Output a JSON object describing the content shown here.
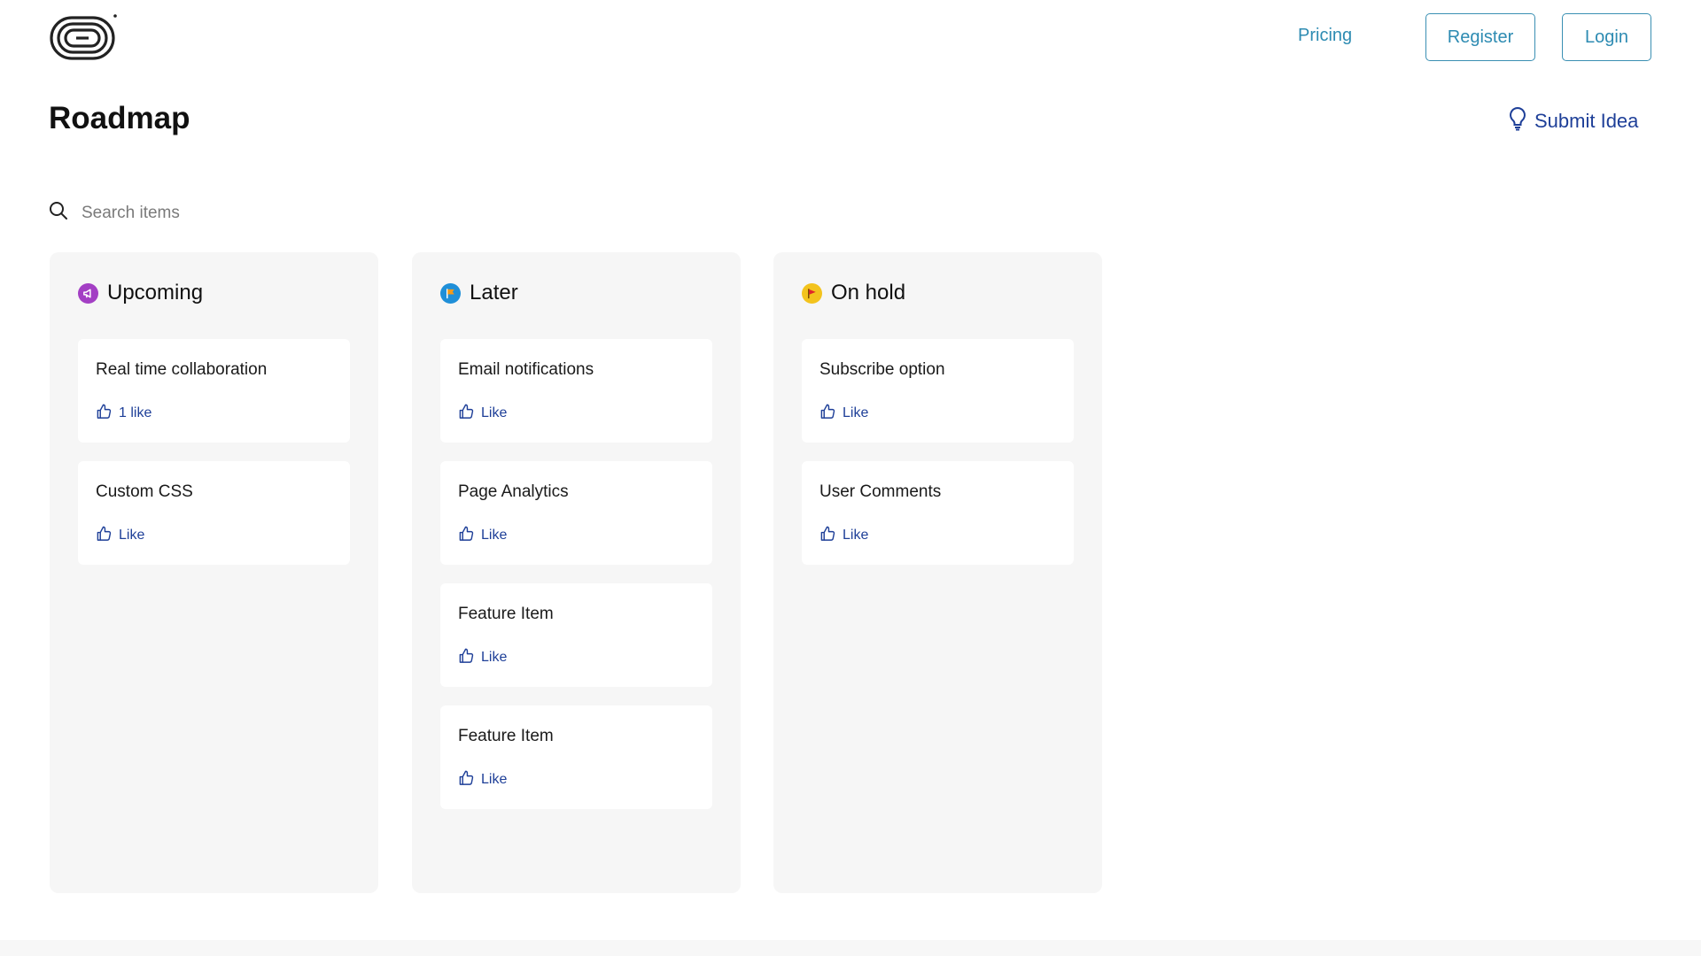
{
  "header": {
    "logo_icon": "brand-logo-icon",
    "nav": {
      "pricing": "Pricing",
      "register": "Register",
      "login": "Login"
    }
  },
  "page": {
    "title": "Roadmap",
    "submit_idea": "Submit Idea"
  },
  "search": {
    "placeholder": "Search items",
    "icon": "search-icon"
  },
  "columns": [
    {
      "title": "Upcoming",
      "icon": "megaphone-icon",
      "icon_color": "#a33fc4",
      "items": [
        {
          "title": "Real time collaboration",
          "like": "1 like"
        },
        {
          "title": "Custom CSS",
          "like": "Like"
        }
      ]
    },
    {
      "title": "Later",
      "icon": "flag-icon",
      "icon_color": "#1f8fd8",
      "items": [
        {
          "title": "Email notifications",
          "like": "Like"
        },
        {
          "title": "Page Analytics",
          "like": "Like"
        },
        {
          "title": "Feature Item",
          "like": "Like"
        },
        {
          "title": "Feature Item",
          "like": "Like"
        }
      ]
    },
    {
      "title": "On hold",
      "icon": "flag-icon",
      "icon_color": "#f3c31d",
      "items": [
        {
          "title": "Subscribe option",
          "like": "Like"
        },
        {
          "title": "User Comments",
          "like": "Like"
        }
      ]
    }
  ],
  "colors": {
    "link_blue": "#2d8bb2",
    "accent_navy": "#1e3f98",
    "column_bg": "#f6f6f6"
  }
}
